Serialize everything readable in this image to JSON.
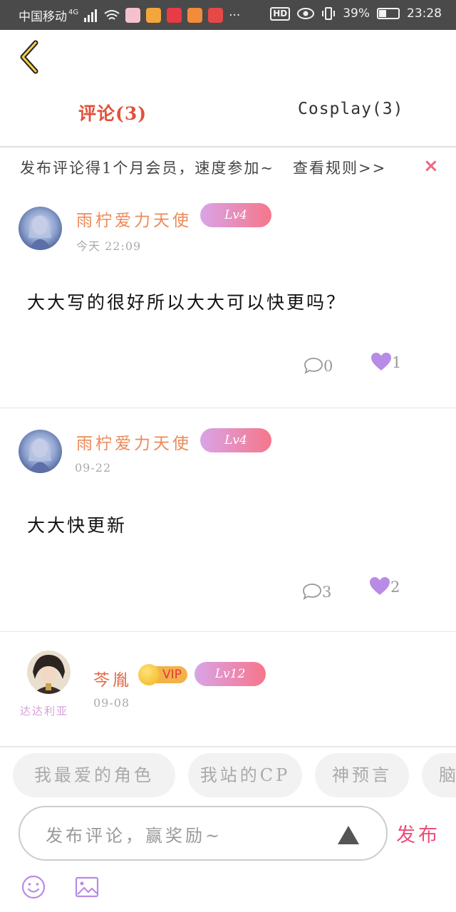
{
  "status_bar": {
    "carrier": "中国移动",
    "network": "4G",
    "more": "···",
    "hd": "HD",
    "battery_percent": "39%",
    "battery_level": 0.39,
    "time": "23:28",
    "app_icon_colors": [
      "#f6c1ce",
      "#f3a63b",
      "#e83b45",
      "#f28c38",
      "#e64848"
    ]
  },
  "header": {
    "tabs": [
      {
        "label": "评论(3)",
        "active": true
      },
      {
        "label": "Cosplay(3)",
        "active": false
      }
    ]
  },
  "notice": {
    "text": "发布评论得1个月会员，速度参加~",
    "link": "查看规则>>",
    "close": "×"
  },
  "comments": [
    {
      "username": "雨柠爱力天使",
      "level": "Lv4",
      "time": "今天  22:09",
      "text": "大大写的很好所以大大可以快更吗？",
      "reply_count": "0",
      "like_count": "1"
    },
    {
      "username": "雨柠爱力天使",
      "level": "Lv4",
      "time": "09-22",
      "text": "大大快更新",
      "reply_count": "3",
      "like_count": "2"
    },
    {
      "username": "芩胤",
      "vip": "VIP",
      "badge": "达达利亚",
      "level": "Lv12",
      "time": "09-08"
    }
  ],
  "quick_tags": [
    "我最爱的角色",
    "我站的CP",
    "神预言",
    "脑"
  ],
  "input": {
    "placeholder": "发布评论，赢奖励~",
    "publish_label": "发布"
  },
  "colors": {
    "accent_red": "#e2513a",
    "username_orange": "#ec8a5a",
    "like_purple": "#b88be6",
    "publish_pink": "#ec4d78"
  }
}
